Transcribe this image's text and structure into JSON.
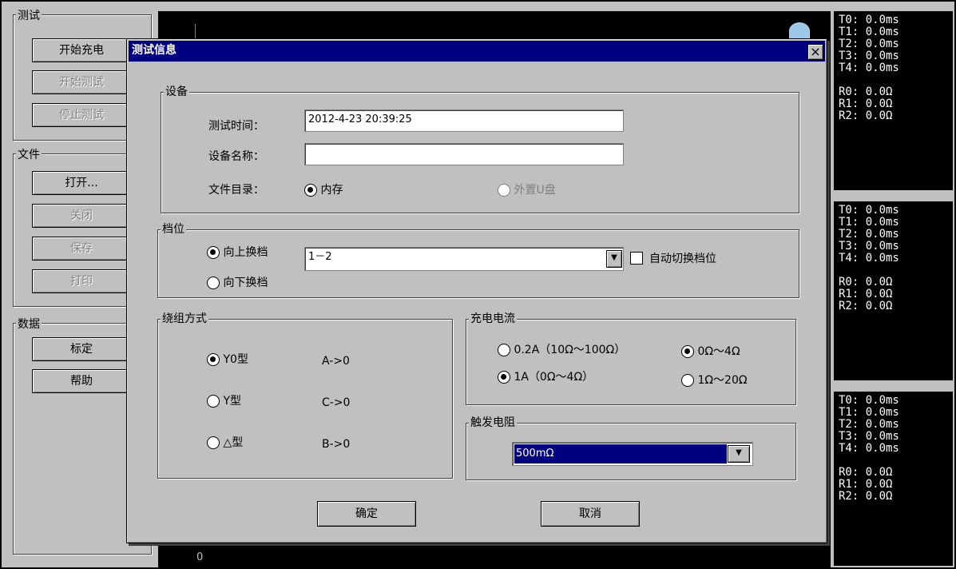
{
  "sidebar": {
    "test_group": {
      "label": "测试",
      "buttons": [
        {
          "label": "开始充电",
          "enabled": true
        },
        {
          "label": "开始测试",
          "enabled": false
        },
        {
          "label": "停止测试",
          "enabled": false
        }
      ]
    },
    "file_group": {
      "label": "文件",
      "buttons": [
        {
          "label": "打开...",
          "enabled": true
        },
        {
          "label": "关闭",
          "enabled": false
        },
        {
          "label": "保存",
          "enabled": false
        },
        {
          "label": "打印",
          "enabled": false
        }
      ]
    },
    "data_group": {
      "label": "数据",
      "buttons": [
        {
          "label": "标定",
          "enabled": true
        },
        {
          "label": "帮助",
          "enabled": true
        }
      ]
    }
  },
  "plot": {
    "axis_label": "0"
  },
  "readouts": [
    {
      "lines": [
        "T0: 0.0ms",
        "T1: 0.0ms",
        "T2: 0.0ms",
        "T3: 0.0ms",
        "T4: 0.0ms",
        "",
        "R0: 0.0Ω",
        "R1: 0.0Ω",
        "R2: 0.0Ω"
      ]
    },
    {
      "lines": [
        "T0: 0.0ms",
        "T1: 0.0ms",
        "T2: 0.0ms",
        "T3: 0.0ms",
        "T4: 0.0ms",
        "",
        "R0: 0.0Ω",
        "R1: 0.0Ω",
        "R2: 0.0Ω"
      ]
    },
    {
      "lines": [
        "T0: 0.0ms",
        "T1: 0.0ms",
        "T2: 0.0ms",
        "T3: 0.0ms",
        "T4: 0.0ms",
        "",
        "R0: 0.0Ω",
        "R1: 0.0Ω",
        "R2: 0.0Ω"
      ]
    }
  ],
  "dialog": {
    "title": "测试信息",
    "close_glyph": "×",
    "device": {
      "label": "设备",
      "test_time_label": "测试时间：",
      "test_time_value": "2012-4-23 20:39:25",
      "device_name_label": "设备名称：",
      "device_name_value": "",
      "file_dir_label": "文件目录：",
      "dir_internal": "内存",
      "dir_usb": "外置U盘"
    },
    "tap": {
      "label": "档位",
      "up_label": "向上换档",
      "down_label": "向下换档",
      "selected": "1－2",
      "auto_switch_label": "自动切换档位",
      "auto_switch_checked": false
    },
    "winding": {
      "label": "绕组方式",
      "options": [
        {
          "label": "Y0型",
          "map": "A->0",
          "selected": true
        },
        {
          "label": "Y型",
          "map": "C->0",
          "selected": false
        },
        {
          "label": "△型",
          "map": "B->0",
          "selected": false
        }
      ]
    },
    "charge_current": {
      "label": "充电电流",
      "opt_02a": "0.2A（10Ω～100Ω）",
      "opt_1a": "1A（0Ω～4Ω）",
      "opt_r1": "0Ω～4Ω",
      "opt_r2": "1Ω～20Ω"
    },
    "trigger_resistor": {
      "label": "触发电阻",
      "selected": "500mΩ"
    },
    "ok_label": "确定",
    "cancel_label": "取消"
  }
}
